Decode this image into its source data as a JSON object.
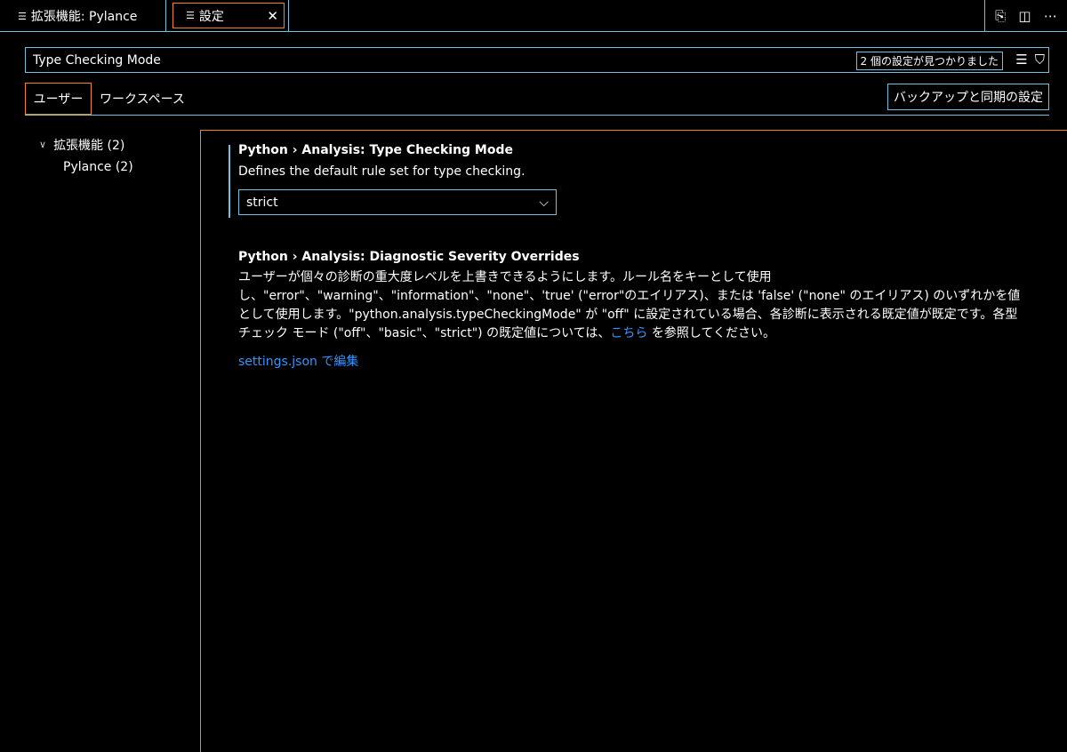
{
  "tabs": {
    "tab1_label": "拡張機能: Pylance",
    "tab2_label": "設定",
    "close_glyph": "✕"
  },
  "toolbar_icons": [
    "open-settings-json-icon",
    "split-editor-icon",
    "more-actions-icon"
  ],
  "search": {
    "value": "Type Checking Mode",
    "result_count": "2 個の設定が見つかりました"
  },
  "scope": {
    "user_label": "ユーザー",
    "workspace_label": "ワークスペース",
    "sync_button": "バックアップと同期の設定"
  },
  "toc": {
    "group_label": "拡張機能 (2)",
    "item_label": "Pylance (2)"
  },
  "settings": [
    {
      "title": "Python › Analysis: Type Checking Mode",
      "description": "Defines the default rule set for type checking.",
      "selected_value": "strict"
    },
    {
      "title": "Python › Analysis: Diagnostic Severity Overrides",
      "description_line1": "ユーザーが個々の診断の重大度レベルを上書きできるようにします。ルール名をキーとして使用",
      "description_line2": "し、\"error\"、\"warning\"、\"information\"、\"none\"、'true' (\"error\"のエイリアス)、または 'false' (\"none\" のエイリアス) のいずれかを値",
      "description_line3": "として使用します。\"python.analysis.typeCheckingMode\" が \"off\" に設定されている場合、各診断に表示される既定値が既定です。各型",
      "description_line4_pre": "チェック モード (\"off\"、\"basic\"、\"strict\") の既定値については、",
      "description_link": "こちら",
      "description_line4_post": " を参照してください。",
      "edit_link": "settings.json で編集"
    }
  ],
  "colors": {
    "contrast_border": "#6fc3df",
    "active_border": "#f38518",
    "link": "#3794ff"
  }
}
